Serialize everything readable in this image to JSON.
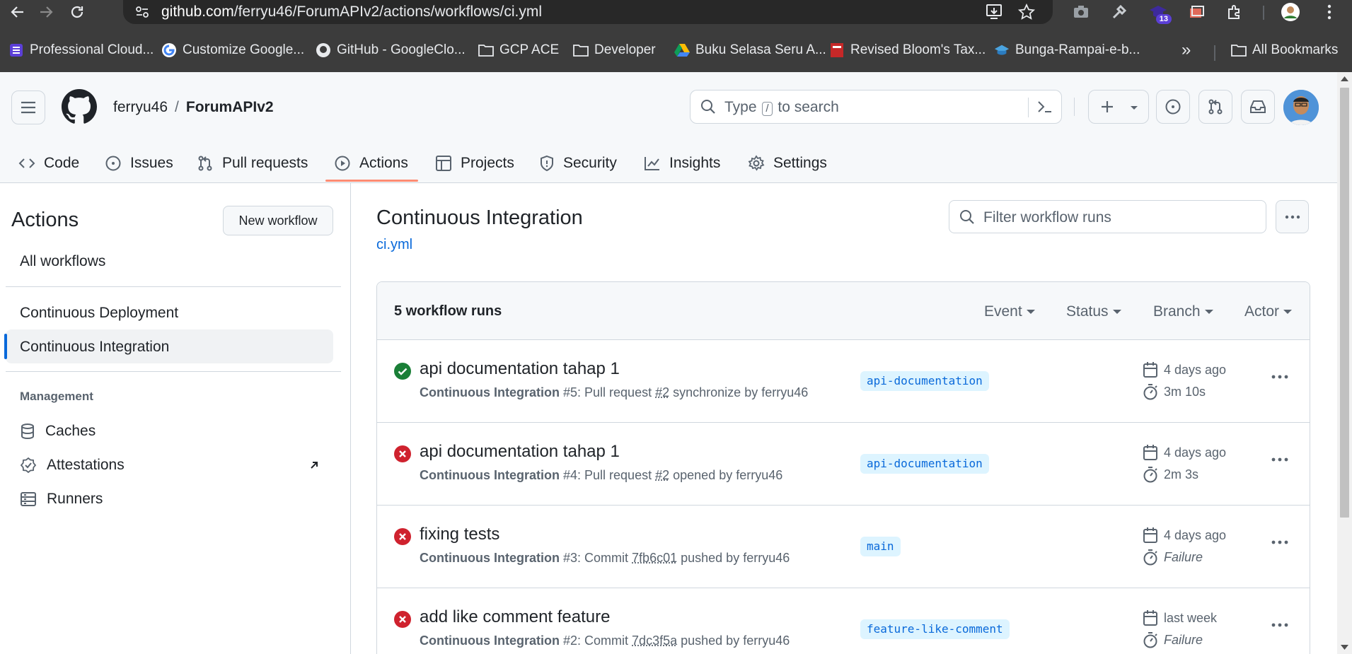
{
  "browser": {
    "url_host": "github.com",
    "url_path": "/ferryu46/ForumAPIv2/actions/workflows/ci.yml",
    "extension_badge": "13",
    "bookmarks": [
      {
        "label": "Professional Cloud...",
        "icon": "list-icon"
      },
      {
        "label": "Customize Google...",
        "icon": "google-icon"
      },
      {
        "label": "GitHub - GoogleClo...",
        "icon": "github-icon"
      },
      {
        "label": "GCP ACE",
        "icon": "folder-icon"
      },
      {
        "label": "Developer",
        "icon": "folder-icon"
      },
      {
        "label": "Buku Selasa Seru A...",
        "icon": "drive-icon"
      },
      {
        "label": "Revised Bloom's Tax...",
        "icon": "book-icon"
      },
      {
        "label": "Bunga-Rampai-e-b...",
        "icon": "graduation-icon"
      }
    ],
    "all_bookmarks": "All Bookmarks",
    "overflow": "»"
  },
  "header": {
    "owner": "ferryu46",
    "separator": "/",
    "repo": "ForumAPIv2",
    "search_prefix": "Type",
    "search_key": "/",
    "search_suffix": "to search"
  },
  "tabs": [
    {
      "label": "Code",
      "icon": "code-icon"
    },
    {
      "label": "Issues",
      "icon": "issue-icon"
    },
    {
      "label": "Pull requests",
      "icon": "pull-request-icon"
    },
    {
      "label": "Actions",
      "icon": "play-icon",
      "active": true
    },
    {
      "label": "Projects",
      "icon": "table-icon"
    },
    {
      "label": "Security",
      "icon": "shield-icon"
    },
    {
      "label": "Insights",
      "icon": "graph-icon"
    },
    {
      "label": "Settings",
      "icon": "gear-icon"
    }
  ],
  "sidebar": {
    "title": "Actions",
    "new_workflow": "New workflow",
    "all_workflows": "All workflows",
    "workflows": [
      "Continuous Deployment",
      "Continuous Integration"
    ],
    "management_label": "Management",
    "management": [
      {
        "label": "Caches",
        "icon": "database-icon"
      },
      {
        "label": "Attestations",
        "icon": "verified-icon"
      },
      {
        "label": "Runners",
        "icon": "server-icon"
      }
    ]
  },
  "main": {
    "title": "Continuous Integration",
    "file": "ci.yml",
    "filter_placeholder": "Filter workflow runs",
    "runs_count": "5 workflow runs",
    "filters": [
      "Event",
      "Status",
      "Branch",
      "Actor"
    ],
    "runs": [
      {
        "status": "success",
        "title": "api documentation tahap 1",
        "workflow": "Continuous Integration",
        "detail_pre": "#5: Pull request",
        "ref": "#2",
        "detail_post": "synchronize by ferryu46",
        "branch": "api-documentation",
        "when": "4 days ago",
        "duration": "3m 10s"
      },
      {
        "status": "failure",
        "title": "api documentation tahap 1",
        "workflow": "Continuous Integration",
        "detail_pre": "#4: Pull request",
        "ref": "#2",
        "detail_post": "opened by ferryu46",
        "branch": "api-documentation",
        "when": "4 days ago",
        "duration": "2m 3s"
      },
      {
        "status": "failure",
        "title": "fixing tests",
        "workflow": "Continuous Integration",
        "detail_pre": "#3: Commit",
        "ref": "7fb6c01",
        "detail_post": "pushed by ferryu46",
        "branch": "main",
        "when": "4 days ago",
        "duration": "Failure"
      },
      {
        "status": "failure",
        "title": "add like comment feature",
        "workflow": "Continuous Integration",
        "detail_pre": "#2: Commit",
        "ref": "7dc3f5a",
        "detail_post": "pushed by ferryu46",
        "branch": "feature-like-comment",
        "when": "last week",
        "duration": "Failure"
      }
    ]
  },
  "colors": {
    "success": "#1a7f37",
    "failure": "#cf222e",
    "accent": "#0969da",
    "tab_underline": "#fd8c73"
  }
}
